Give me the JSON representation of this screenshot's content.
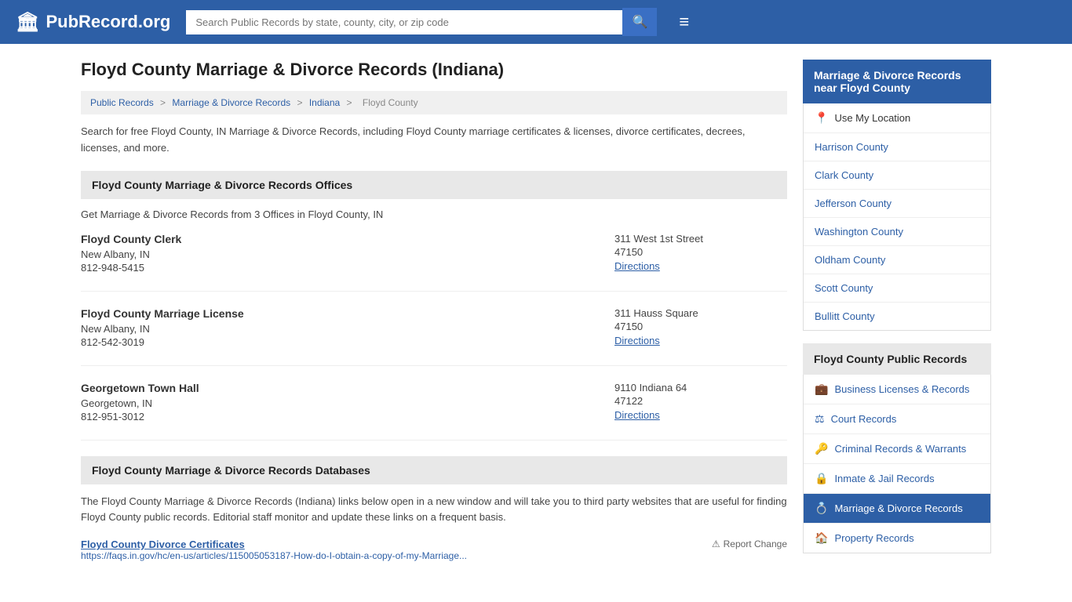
{
  "header": {
    "logo_text": "PubRecord.org",
    "logo_icon": "🏛",
    "search_placeholder": "Search Public Records by state, county, city, or zip code",
    "search_btn_icon": "🔍",
    "menu_icon": "≡"
  },
  "page": {
    "title": "Floyd County Marriage & Divorce Records (Indiana)",
    "description": "Search for free Floyd County, IN Marriage & Divorce Records, including Floyd County marriage certificates & licenses, divorce certificates, decrees, licenses, and more."
  },
  "breadcrumb": {
    "items": [
      "Public Records",
      "Marriage & Divorce Records",
      "Indiana",
      "Floyd County"
    ]
  },
  "offices_section": {
    "header": "Floyd County Marriage & Divorce Records Offices",
    "description": "Get Marriage & Divorce Records from 3 Offices in Floyd County, IN",
    "offices": [
      {
        "name": "Floyd County Clerk",
        "city": "New Albany, IN",
        "phone": "812-948-5415",
        "address": "311 West 1st Street",
        "zip": "47150",
        "directions": "Directions"
      },
      {
        "name": "Floyd County Marriage License",
        "city": "New Albany, IN",
        "phone": "812-542-3019",
        "address": "311 Hauss Square",
        "zip": "47150",
        "directions": "Directions"
      },
      {
        "name": "Georgetown Town Hall",
        "city": "Georgetown, IN",
        "phone": "812-951-3012",
        "address": "9110 Indiana 64",
        "zip": "47122",
        "directions": "Directions"
      }
    ]
  },
  "databases_section": {
    "header": "Floyd County Marriage & Divorce Records Databases",
    "description": "The Floyd County Marriage & Divorce Records (Indiana) links below open in a new window and will take you to third party websites that are useful for finding Floyd County public records. Editorial staff monitor and update these links on a frequent basis.",
    "entries": [
      {
        "title": "Floyd County Divorce Certificates",
        "url": "https://faqs.in.gov/hc/en-us/articles/115005053187-How-do-I-obtain-a-copy-of-my-Marriage...",
        "report_change": "Report Change",
        "report_icon": "⚠"
      }
    ]
  },
  "sidebar": {
    "nearby_title": "Marriage & Divorce Records near Floyd County",
    "use_location": "Use My Location",
    "use_location_icon": "📍",
    "nearby_counties": [
      "Harrison County",
      "Clark County",
      "Jefferson County",
      "Washington County",
      "Oldham County",
      "Scott County",
      "Bullitt County"
    ],
    "public_records_title": "Floyd County Public Records",
    "records": [
      {
        "label": "Business Licenses & Records",
        "icon": "💼",
        "active": false
      },
      {
        "label": "Court Records",
        "icon": "⚖",
        "active": false
      },
      {
        "label": "Criminal Records & Warrants",
        "icon": "🔑",
        "active": false
      },
      {
        "label": "Inmate & Jail Records",
        "icon": "🔒",
        "active": false
      },
      {
        "label": "Marriage & Divorce Records",
        "icon": "💍",
        "active": true
      },
      {
        "label": "Property Records",
        "icon": "🏠",
        "active": false
      }
    ]
  }
}
